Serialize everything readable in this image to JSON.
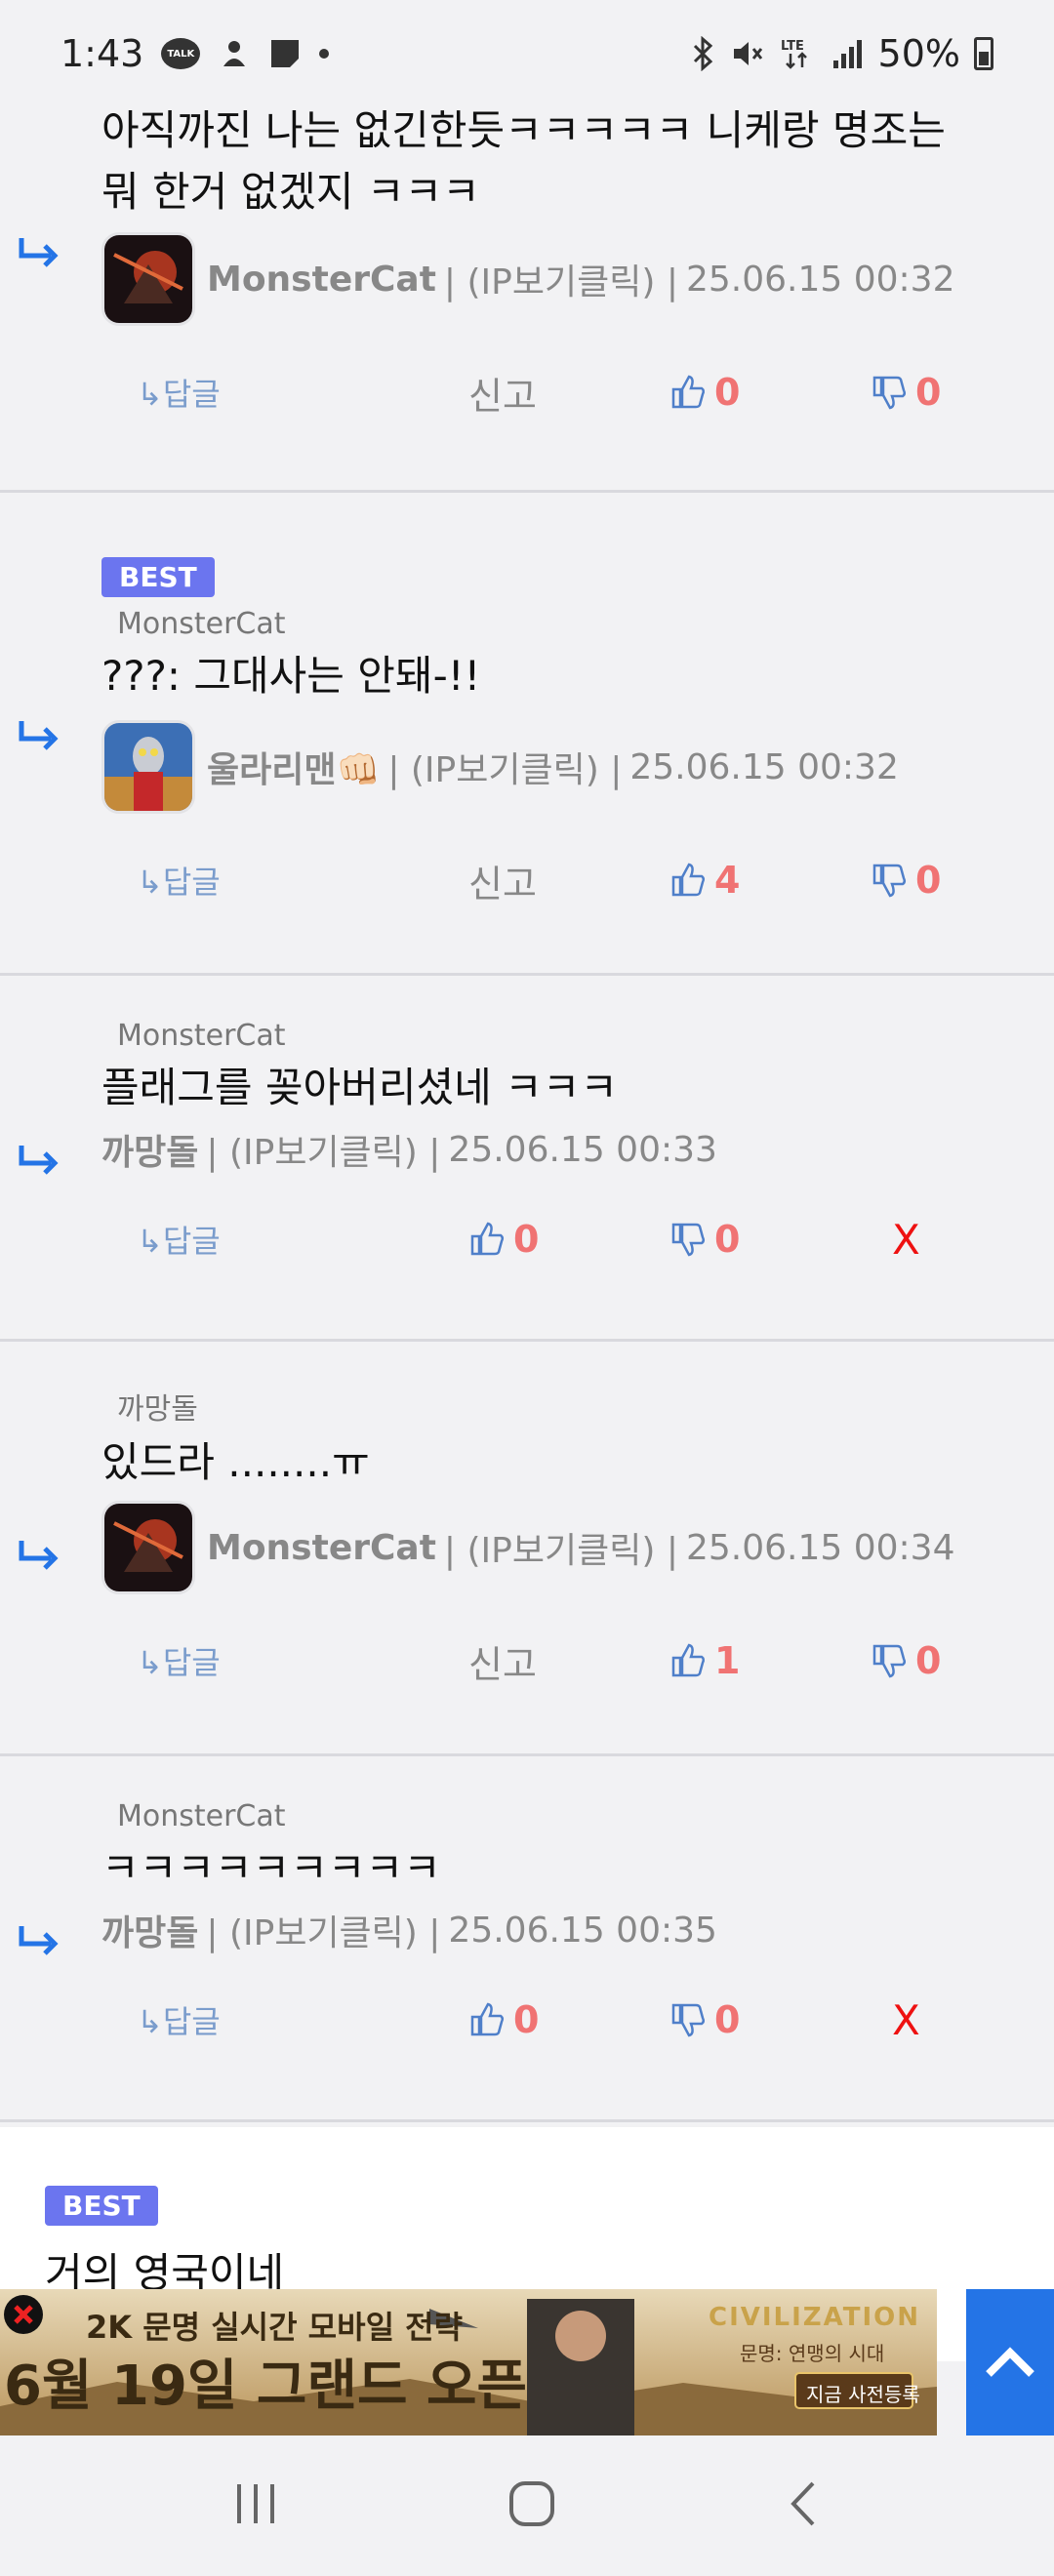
{
  "status_bar": {
    "time": "1:43",
    "talk_icon_text": "TALK",
    "battery": "50%"
  },
  "comments": [
    {
      "text_lines": [
        "아직까진 나는 없긴한듯ㅋㅋㅋㅋㅋ 니케랑 명조는",
        "뭐 한거 없겠지 ㅋㅋㅋ"
      ],
      "author": "MonsterCat",
      "ip_label": "| (IP보기클릭) |",
      "date": "25.06.15 00:32",
      "reply_label": "↳답글",
      "report_label": "신고",
      "like": "0",
      "dislike": "0"
    },
    {
      "best_label": "BEST",
      "target": "MonsterCat",
      "text_lines": [
        "???: 그대사는 안돼-!!"
      ],
      "author": "울라리맨👊🏻",
      "ip_label": "| (IP보기클릭) |",
      "date": "25.06.15 00:32",
      "reply_label": "↳답글",
      "report_label": "신고",
      "like": "4",
      "dislike": "0"
    },
    {
      "target": "MonsterCat",
      "text_lines": [
        "플래그를 꽂아버리셨네 ㅋㅋㅋ"
      ],
      "author": "까망돌",
      "ip_label": "| (IP보기클릭) |",
      "date": "25.06.15 00:33",
      "reply_label": "↳답글",
      "like": "0",
      "dislike": "0",
      "delete_label": "X"
    },
    {
      "target": "까망돌",
      "text_lines": [
        "있드라 ........ㅠ"
      ],
      "author": "MonsterCat",
      "ip_label": "| (IP보기클릭) |",
      "date": "25.06.15 00:34",
      "reply_label": "↳답글",
      "report_label": "신고",
      "like": "1",
      "dislike": "0"
    },
    {
      "target": "MonsterCat",
      "text_lines": [
        "ㅋㅋㅋㅋㅋㅋㅋㅋㅋ"
      ],
      "author": "까망돌",
      "ip_label": "| (IP보기클릭) |",
      "date": "25.06.15 00:35",
      "reply_label": "↳답글",
      "like": "0",
      "dislike": "0",
      "delete_label": "X"
    }
  ],
  "next_comment": {
    "best_label": "BEST",
    "text": "거의 영국이네"
  },
  "ad": {
    "line1": "2K 문명 실시간 모바일 전략",
    "line2": "6월 19일 그랜드 오픈",
    "brand": "CIVILIZATION",
    "brand_sub": "문명: 연맹의 시대",
    "cta": "지금 사전등록"
  },
  "colors": {
    "accent_blue": "#2474e6",
    "best_badge": "#6b75ef",
    "count_red": "#f07373"
  }
}
